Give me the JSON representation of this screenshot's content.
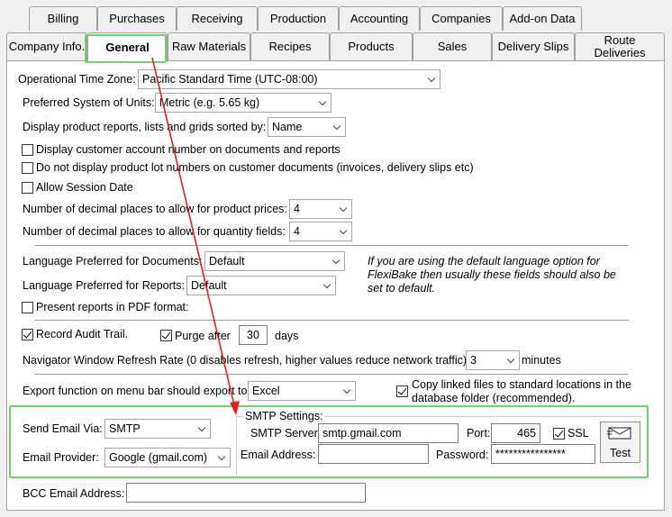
{
  "tabs_row1": [
    {
      "label": "Billing"
    },
    {
      "label": "Purchases"
    },
    {
      "label": "Receiving"
    },
    {
      "label": "Production"
    },
    {
      "label": "Accounting"
    },
    {
      "label": "Companies"
    },
    {
      "label": "Add-on Data"
    }
  ],
  "tabs_row2": [
    {
      "label": "Company Info."
    },
    {
      "label": "General"
    },
    {
      "label": "Raw Materials"
    },
    {
      "label": "Recipes"
    },
    {
      "label": "Products"
    },
    {
      "label": "Sales"
    },
    {
      "label": "Delivery Slips"
    },
    {
      "label": "Route Deliveries"
    }
  ],
  "general": {
    "time_zone_label": "Operational Time Zone:",
    "time_zone_value": "Pacific Standard Time (UTC-08:00)",
    "units_label": "Preferred System of Units:",
    "units_value": "Metric (e.g. 5.65 kg)",
    "sort_label": "Display product reports, lists and grids sorted by:",
    "sort_value": "Name",
    "cust_account_label": "Display customer account number on documents and reports",
    "cust_account_checked": false,
    "lot_numbers_label": "Do not display product lot numbers on customer documents (invoices, delivery slips etc)",
    "lot_numbers_checked": false,
    "session_date_label": "Allow Session Date",
    "session_date_checked": false,
    "price_decimals_label": "Number of decimal places to allow for product prices:",
    "price_decimals_value": "4",
    "qty_decimals_label": "Number of decimal places to allow for quantity fields:",
    "qty_decimals_value": "4",
    "lang_docs_label": "Language Preferred for Documents:",
    "lang_docs_value": "Default",
    "lang_reports_label": "Language Preferred for Reports:",
    "lang_reports_value": "Default",
    "lang_note": "If you are using the default language option for FlexiBake then usually these fields should also be set to default.",
    "pdf_label": "Present reports in PDF format:",
    "pdf_checked": false,
    "audit_label": "Record Audit Trail.",
    "audit_checked": true,
    "purge_label": "Purge after",
    "purge_checked": true,
    "purge_days": "30",
    "days_label": "days",
    "refresh_label": "Navigator Window Refresh Rate (0 disables refresh, higher values reduce network traffic)",
    "refresh_value": "3",
    "minutes_label": "minutes",
    "export_label": "Export function on menu bar should export to:",
    "export_value": "Excel",
    "copy_linked_label": "Copy linked files to standard locations in the database folder (recommended).",
    "copy_linked_checked": true
  },
  "email": {
    "send_via_label": "Send Email Via:",
    "send_via_value": "SMTP",
    "provider_label": "Email Provider:",
    "provider_value": "Google (gmail.com)",
    "smtp_settings_label": "SMTP Settings:",
    "server_label": "SMTP Server:",
    "server_value": "smtp.gmail.com",
    "port_label": "Port:",
    "port_value": "465",
    "ssl_label": "SSL",
    "ssl_checked": true,
    "address_label": "Email Address:",
    "address_value": "",
    "password_label": "Password:",
    "password_value": "****************",
    "test_label": "Test",
    "bcc_label": "BCC Email Address:",
    "bcc_value": ""
  },
  "colors": {
    "highlight": "#6dd36d",
    "arrow": "#e02020"
  }
}
